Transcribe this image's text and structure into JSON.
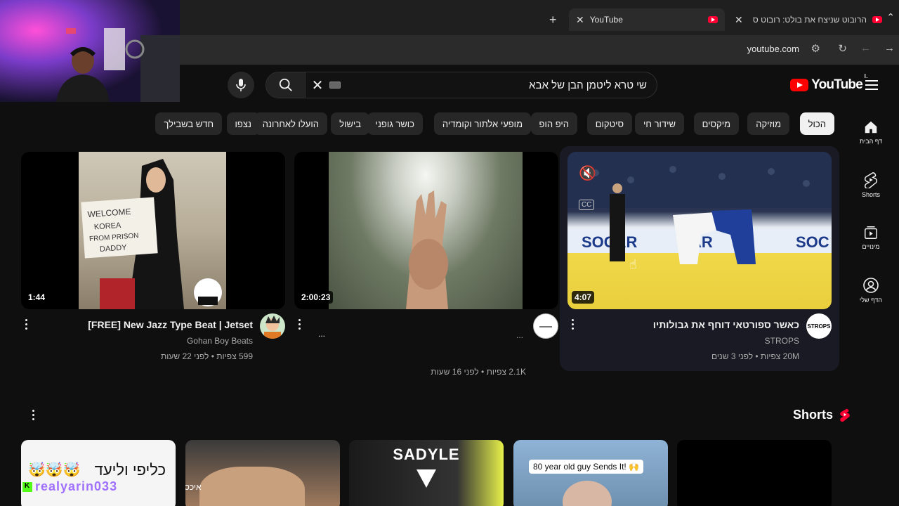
{
  "browser": {
    "tabs": [
      {
        "title": "YouTube",
        "active": true
      },
      {
        "title": "הרובוט שניצח את בולט: רובוט ס",
        "active": false
      }
    ],
    "new_tab_label": "+",
    "url": "youtube.com"
  },
  "youtube": {
    "logo_text": "YouTube",
    "country_code": "IL",
    "search": {
      "query": "שי טרא ליטמן הבן של אבא"
    },
    "sidebar": [
      {
        "label": "דף הבית",
        "icon": "home-icon"
      },
      {
        "label": "Shorts",
        "icon": "shorts-icon"
      },
      {
        "label": "מינויים",
        "icon": "subscriptions-icon"
      },
      {
        "label": "הדף שלי",
        "icon": "account-icon"
      }
    ],
    "chips": [
      {
        "label": "הכול",
        "selected": true
      },
      {
        "label": "מוזיקה"
      },
      {
        "label": "מיקסים"
      },
      {
        "label": "שידור חי"
      },
      {
        "label": "סיטקום"
      },
      {
        "label": "היפ הופ"
      },
      {
        "label": "מופעי אלתור וקומדיה"
      },
      {
        "label": "כושר גופני"
      },
      {
        "label": "בישול"
      },
      {
        "label": "הועלו לאחרונה"
      },
      {
        "label": "נצפו"
      },
      {
        "label": "חדש בשבילך"
      }
    ],
    "videos": [
      {
        "title": "כאשר ספורטאי דוחף את גבולותיו",
        "channel": "STROPS",
        "stats": "20M צפיות • לפני 3 שנים",
        "duration": "4:07",
        "thumb_text": "SOCAR",
        "avatar_text": "STROPS"
      },
      {
        "title": "",
        "channel": "...",
        "stats": "2.1K צפיות • לפני 16 שעות",
        "duration": "2:00:23",
        "channel_dots": "..."
      },
      {
        "title": "[FREE] New Jazz Type Beat | Jetset",
        "channel": "Gohan Boy Beats",
        "stats": "599 צפיות • לפני 22 שעות",
        "duration": "1:44",
        "thumb_text": "WELCOME KOREA FROM PRISON DADDY"
      }
    ],
    "shorts": {
      "title": "Shorts",
      "items": [
        {
          "caption": "80 year old guy Sends It! 🙌"
        },
        {
          "caption": "SADYLE"
        },
        {
          "caption": "איכס"
        },
        {
          "caption": "כליפי וליעד"
        }
      ]
    }
  },
  "webcam": {
    "overlay_text": "realyarin033"
  },
  "colors": {
    "background": "#0f0f0f",
    "accent": "#ff0000",
    "hovercard": "#1a1a24"
  }
}
